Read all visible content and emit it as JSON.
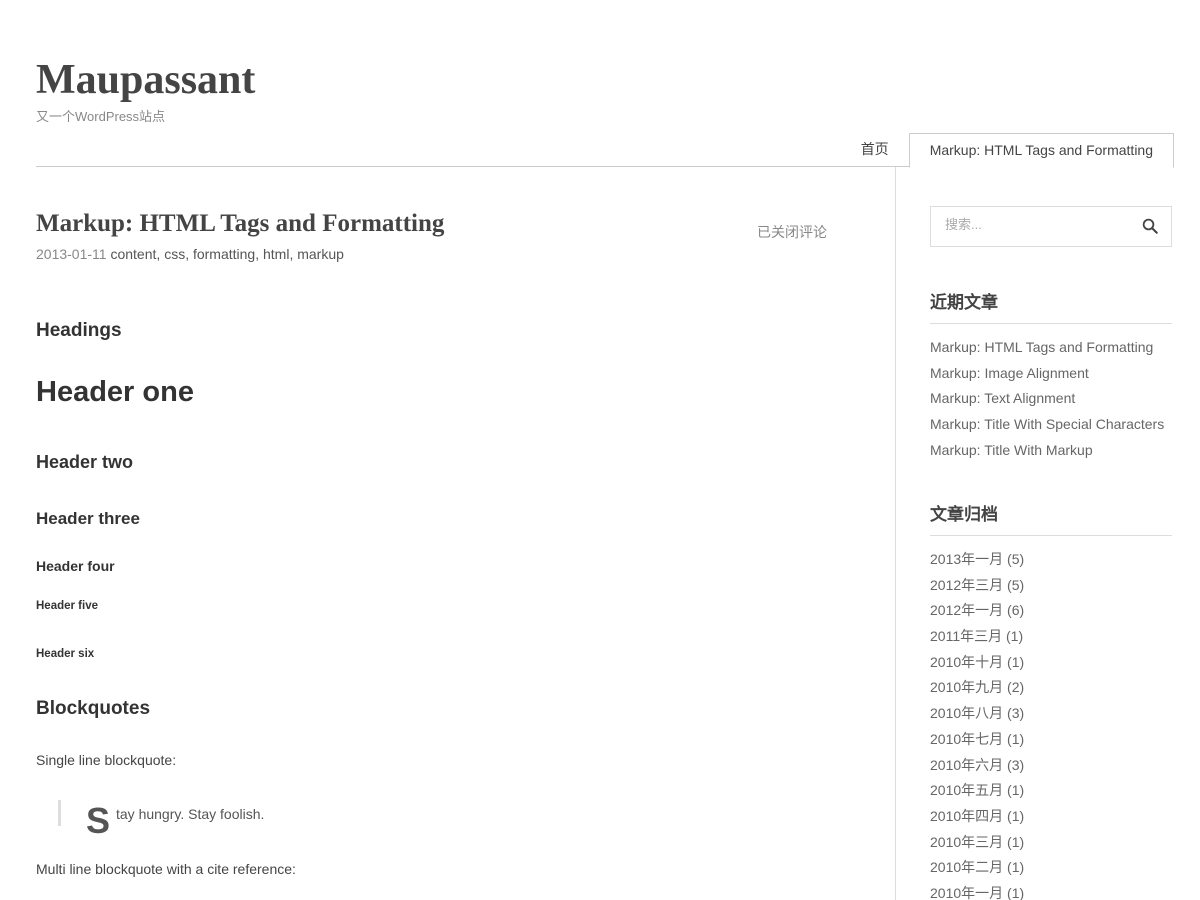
{
  "site": {
    "title": "Maupassant",
    "description": "又一个WordPress站点"
  },
  "nav": {
    "items": [
      {
        "label": "首页",
        "current": false
      },
      {
        "label": "Markup: HTML Tags and Formatting",
        "current": true
      }
    ]
  },
  "post": {
    "title": "Markup: HTML Tags and Formatting",
    "comments_status": "已关闭评论",
    "date": "2013-01-11",
    "tags": [
      "content",
      "css",
      "formatting",
      "html",
      "markup"
    ],
    "tag_separator": ",",
    "sections": {
      "headings_title": "Headings",
      "h1": "Header one",
      "h2": "Header two",
      "h3": "Header three",
      "h4": "Header four",
      "h5": "Header five",
      "h6": "Header six",
      "blockquotes_title": "Blockquotes",
      "single_line_label": "Single line blockquote:",
      "blockquote_dropcap": "S",
      "blockquote_text": "tay hungry. Stay foolish.",
      "multi_line_label": "Multi line blockquote with a cite reference:"
    }
  },
  "sidebar": {
    "search": {
      "placeholder": "搜索...",
      "icon": "search-icon"
    },
    "recent_posts": {
      "title": "近期文章",
      "items": [
        "Markup: HTML Tags and Formatting",
        "Markup: Image Alignment",
        "Markup: Text Alignment",
        "Markup: Title With Special Characters",
        "Markup: Title With Markup"
      ]
    },
    "archives": {
      "title": "文章归档",
      "items": [
        "2013年一月 (5)",
        "2012年三月 (5)",
        "2012年一月 (6)",
        "2011年三月 (1)",
        "2010年十月 (1)",
        "2010年九月 (2)",
        "2010年八月 (3)",
        "2010年七月 (1)",
        "2010年六月 (3)",
        "2010年五月 (1)",
        "2010年四月 (1)",
        "2010年三月 (1)",
        "2010年二月 (1)",
        "2010年一月 (1)"
      ]
    }
  },
  "colors": {
    "text": "#444444",
    "muted": "#888888",
    "border": "#dddddd"
  }
}
